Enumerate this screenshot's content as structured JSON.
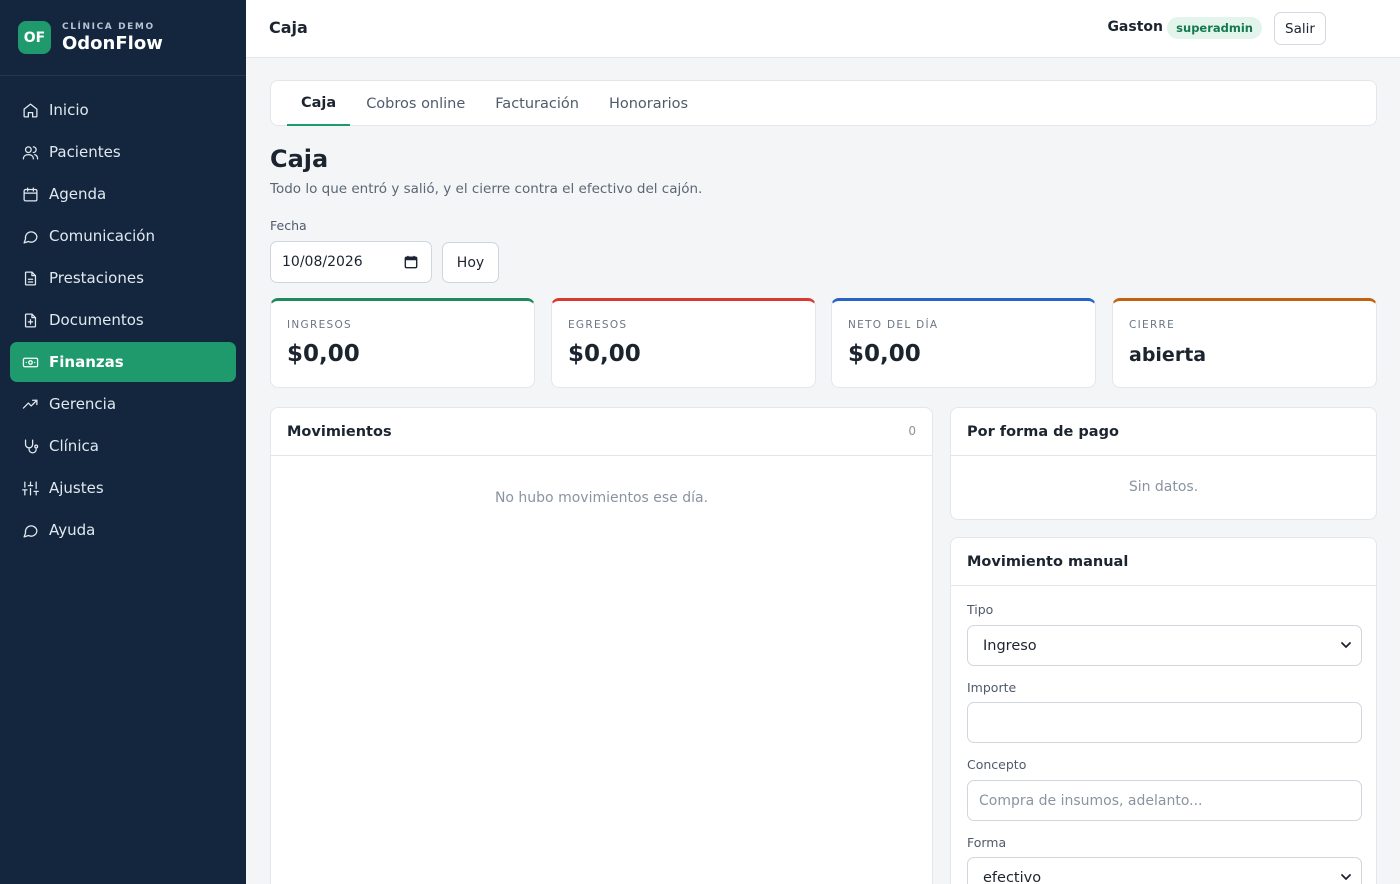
{
  "brand": {
    "logo": "OF",
    "subtitle": "CLÍNICA DEMO",
    "name": "OdonFlow"
  },
  "sidebar": {
    "items": [
      {
        "label": "Inicio",
        "icon": "home-icon"
      },
      {
        "label": "Pacientes",
        "icon": "users-icon"
      },
      {
        "label": "Agenda",
        "icon": "calendar-icon"
      },
      {
        "label": "Comunicación",
        "icon": "chat-icon"
      },
      {
        "label": "Prestaciones",
        "icon": "document-icon"
      },
      {
        "label": "Documentos",
        "icon": "file-plus-icon"
      },
      {
        "label": "Finanzas",
        "icon": "banknote-icon",
        "active": true
      },
      {
        "label": "Gerencia",
        "icon": "trending-up-icon"
      },
      {
        "label": "Clínica",
        "icon": "stethoscope-icon"
      },
      {
        "label": "Ajustes",
        "icon": "sliders-icon"
      },
      {
        "label": "Ayuda",
        "icon": "help-chat-icon"
      }
    ]
  },
  "topbar": {
    "title": "Caja",
    "user": "Gaston",
    "role": "superadmin",
    "logout": "Salir"
  },
  "tabs": [
    {
      "label": "Caja",
      "active": true
    },
    {
      "label": "Cobros online"
    },
    {
      "label": "Facturación"
    },
    {
      "label": "Honorarios"
    }
  ],
  "page": {
    "title": "Caja",
    "subtitle": "Todo lo que entró y salió, y el cierre contra el efectivo del cajón.",
    "date_label": "Fecha",
    "date_value": "10/08/2026",
    "today_button": "Hoy"
  },
  "stats": [
    {
      "label": "INGRESOS",
      "value": "$0,00",
      "color": "#1e8a5c"
    },
    {
      "label": "EGRESOS",
      "value": "$0,00",
      "color": "#d93a2f"
    },
    {
      "label": "NETO DEL DÍA",
      "value": "$0,00",
      "color": "#2563c9"
    },
    {
      "label": "CIERRE",
      "value": "abierta",
      "color": "#c2610f"
    }
  ],
  "movements": {
    "title": "Movimientos",
    "count": "0",
    "empty": "No hubo movimientos ese día."
  },
  "payment_methods": {
    "title": "Por forma de pago",
    "empty": "Sin datos."
  },
  "manual": {
    "title": "Movimiento manual",
    "type_label": "Tipo",
    "type_value": "Ingreso",
    "amount_label": "Importe",
    "amount_value": "",
    "concept_label": "Concepto",
    "concept_placeholder": "Compra de insumos, adelanto...",
    "method_label": "Forma",
    "method_value": "efectivo"
  }
}
